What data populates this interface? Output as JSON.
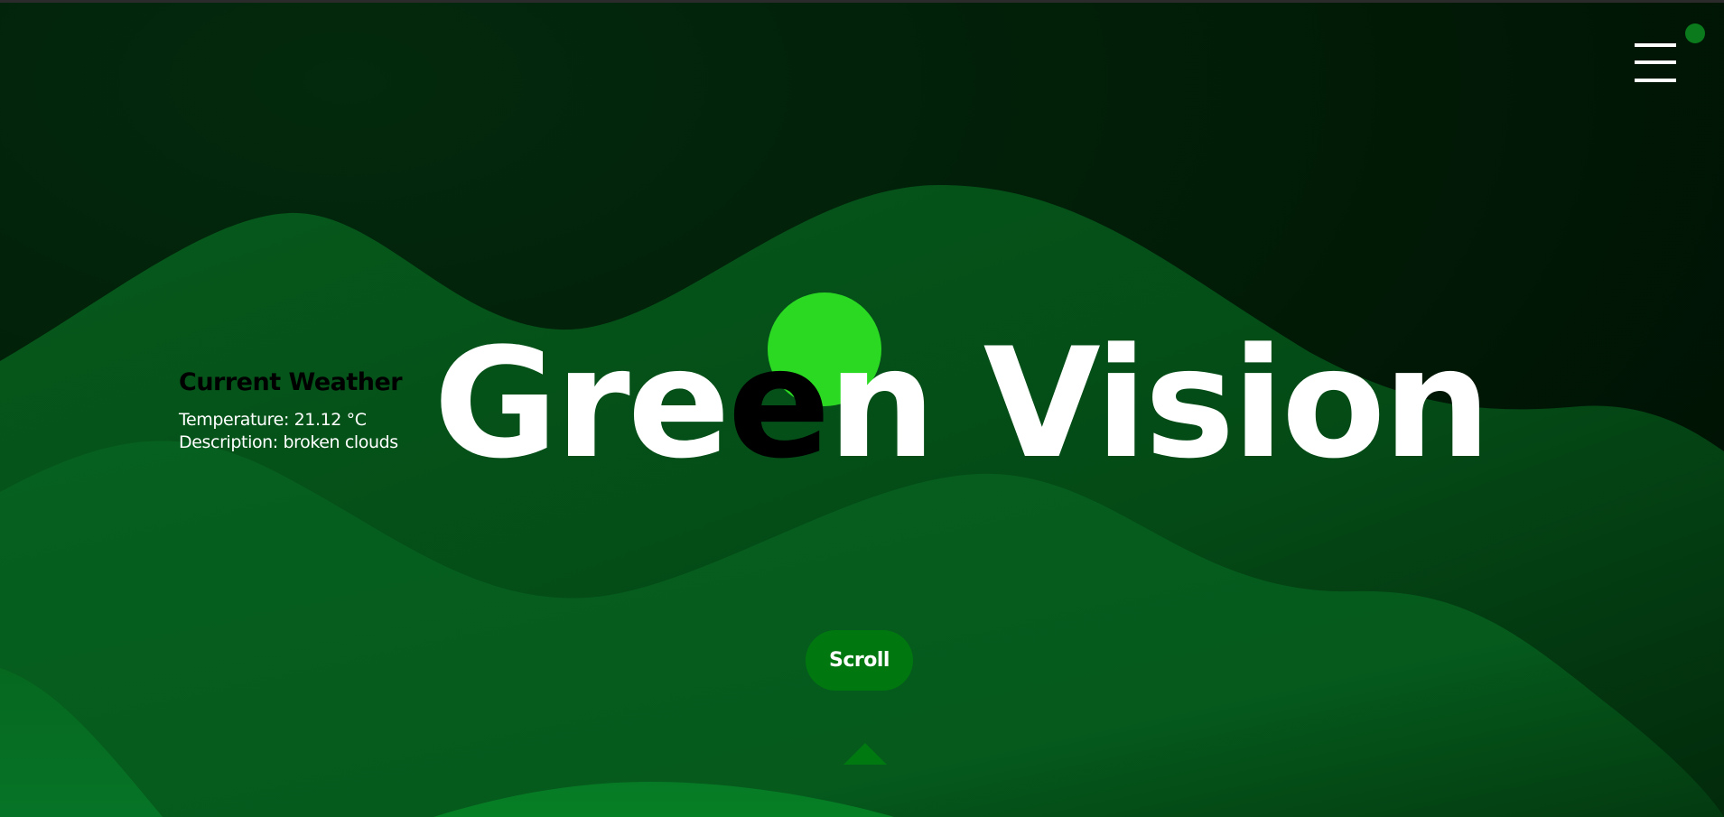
{
  "header": {
    "menu_icon": "hamburger-menu-icon",
    "notification_icon": "notification-dot-icon"
  },
  "weather": {
    "title": "Current Weather",
    "temperature_line": "Temperature: 21.12 °C",
    "description_line": "Description: broken clouds"
  },
  "hero": {
    "title_part1": "Gre",
    "title_highlight": "e",
    "title_part2": "n Vision",
    "sun_icon": "sun-circle-icon"
  },
  "scroll": {
    "label": "Scroll",
    "arrow_icon": "up-arrow-icon"
  },
  "colors": {
    "background_dark": "#011a06",
    "hill_back": "#054f18",
    "hill_mid": "#06661f",
    "hill_front": "#067a24",
    "sun": "#2bd923",
    "button": "#00780f",
    "notification_dot": "#0a7a1c",
    "text_light": "#ffffff",
    "text_dark": "#000000"
  }
}
